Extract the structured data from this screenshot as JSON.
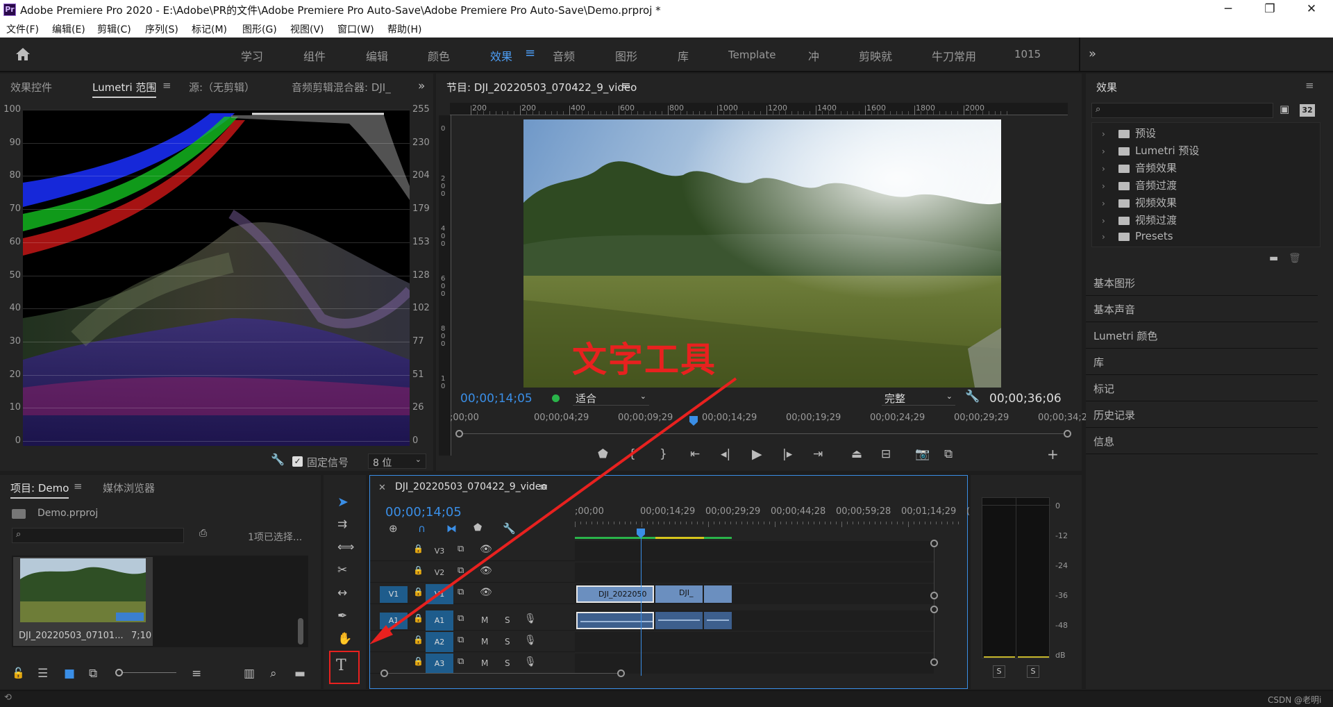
{
  "window": {
    "title": "Adobe Premiere Pro 2020 - E:\\Adobe\\PR的文件\\Adobe Premiere Pro Auto-Save\\Adobe Premiere Pro Auto-Save\\Demo.prproj *",
    "app_icon_text": "Pr"
  },
  "menu": [
    "文件(F)",
    "编辑(E)",
    "剪辑(C)",
    "序列(S)",
    "标记(M)",
    "图形(G)",
    "视图(V)",
    "窗口(W)",
    "帮助(H)"
  ],
  "workspaces": [
    "学习",
    "组件",
    "编辑",
    "颜色",
    "效果",
    "音频",
    "图形",
    "库",
    "Template",
    "冲",
    "剪映就",
    "牛刀常用",
    "1015"
  ],
  "active_workspace": "效果",
  "left_tabs": [
    "效果控件",
    "Lumetri 范围",
    "源:（无剪辑）",
    "音频剪辑混合器: DJI_"
  ],
  "scope": {
    "left_ticks": [
      "100",
      "90",
      "80",
      "70",
      "60",
      "50",
      "40",
      "30",
      "20",
      "10",
      "0"
    ],
    "right_ticks": [
      "255",
      "230",
      "204",
      "179",
      "153",
      "128",
      "102",
      "77",
      "51",
      "26",
      "0"
    ],
    "clamp_label": "固定信号",
    "bit_depth": "8 位"
  },
  "program": {
    "title": "节目: DJI_20220503_070422_9_video",
    "ruler_h": [
      "200",
      "200",
      "400",
      "600",
      "800",
      "1000",
      "1200",
      "1400",
      "1600",
      "1800",
      "2000"
    ],
    "ruler_v": [
      "0",
      "2 0 0",
      "4 0 0",
      "6 0 0",
      "8 0 0",
      "1 0"
    ],
    "timecode": "00;00;14;05",
    "fit": "适合",
    "quality": "完整",
    "duration": "00;00;36;06",
    "time_ruler": [
      ";00;00",
      "00;00;04;29",
      "00;00;09;29",
      "00;00;14;29",
      "00;00;19;29",
      "00;00;24;29",
      "00;00;29;29",
      "00;00;34;28"
    ],
    "annotation": "文字工具"
  },
  "effects_panel": {
    "title": "效果",
    "tree": [
      "预设",
      "Lumetri 预设",
      "音频效果",
      "音频过渡",
      "视频效果",
      "视频过渡",
      "Presets"
    ],
    "collapsed_panels": [
      "基本图形",
      "基本声音",
      "Lumetri 颜色",
      "库",
      "标记",
      "历史记录",
      "信息"
    ]
  },
  "project": {
    "tabs": [
      "项目: Demo",
      "媒体浏览器"
    ],
    "file": "Demo.prproj",
    "selection": "1项已选择...",
    "clip_name": "DJI_20220503_07101...",
    "clip_duration": "7;10"
  },
  "timeline": {
    "tab": "DJI_20220503_070422_9_video",
    "timecode": "00;00;14;05",
    "ruler": [
      ";00;00",
      "00;00;14;29",
      "00;00;29;29",
      "00;00;44;28",
      "00;00;59;28",
      "00;01;14;29",
      "("
    ],
    "video_tracks": [
      "V3",
      "V2",
      "V1"
    ],
    "audio_tracks": [
      "A1",
      "A2",
      "A3"
    ],
    "v1_source": "V1",
    "a1_source": "A1",
    "clip_labels": [
      "DJI_2022050",
      "DJI_"
    ],
    "track_letters": {
      "mute": "M",
      "solo": "S"
    }
  },
  "audio_meter": {
    "scale": [
      "0",
      "-12",
      "-24",
      "-36",
      "-48",
      "dB"
    ],
    "solo": [
      "S",
      "S"
    ]
  },
  "statusbar": {
    "watermark": "CSDN @老明i"
  },
  "colors": {
    "accent": "#4d9ef5",
    "annotation": "#e8211f",
    "clip_blue": "#6b8fbf"
  }
}
